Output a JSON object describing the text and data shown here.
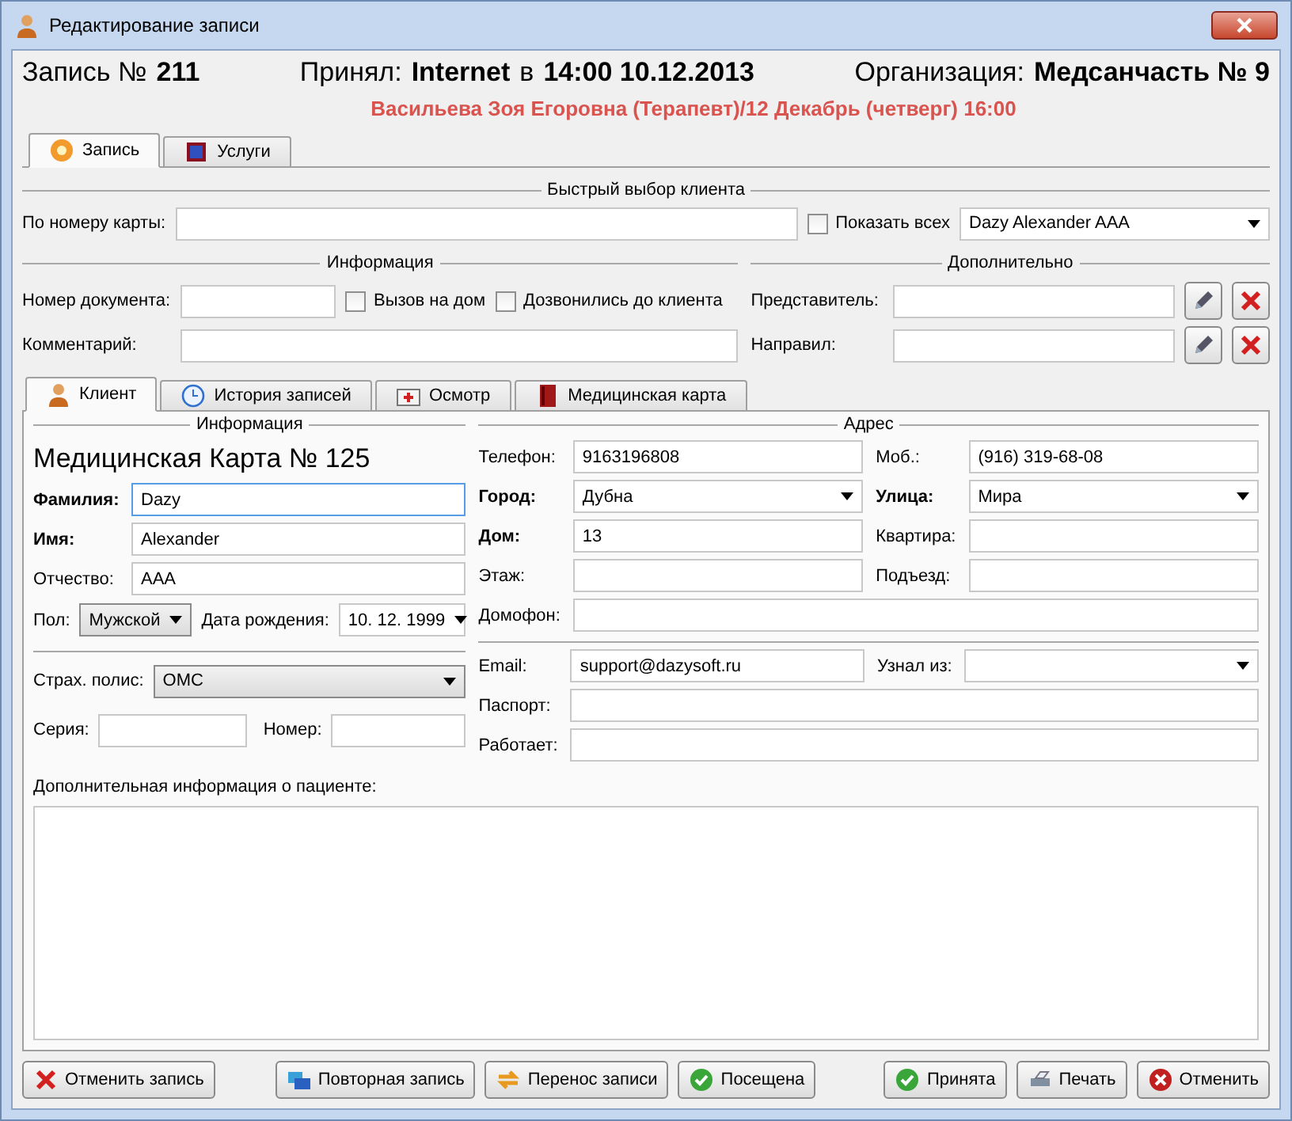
{
  "window": {
    "title": "Редактирование записи"
  },
  "header": {
    "record_label": "Запись №",
    "record_number": "211",
    "accepted_label": "Принял:",
    "accepted_by": "Internet",
    "at_word": "в",
    "accepted_time": "14:00 10.12.2013",
    "org_label": "Организация:",
    "org_name": "Медсанчасть № 9",
    "appointment": "Васильева Зоя Егоровна (Терапевт)/12 Декабрь (четверг) 16:00"
  },
  "top_tabs": [
    {
      "label": "Запись",
      "selected": true
    },
    {
      "label": "Услуги",
      "selected": false
    }
  ],
  "quick_select": {
    "title": "Быстрый выбор клиента",
    "card_label": "По номеру карты:",
    "show_all": {
      "label": "Показать всех",
      "checked": false
    },
    "client": "Dazy Alexander AAA"
  },
  "info": {
    "title": "Информация",
    "doc_label": "Номер документа:",
    "home_call": {
      "label": "Вызов на дом",
      "checked": false
    },
    "called": {
      "label": "Дозвонились до клиента",
      "checked": false
    },
    "comment_label": "Комментарий:"
  },
  "extra": {
    "title": "Дополнительно",
    "rows": [
      {
        "label": "Представитель:"
      },
      {
        "label": "Направил:"
      }
    ]
  },
  "client_tabs": [
    {
      "label": "Клиент",
      "selected": true
    },
    {
      "label": "История записей",
      "selected": false
    },
    {
      "label": "Осмотр",
      "selected": false
    },
    {
      "label": "Медицинская карта",
      "selected": false
    }
  ],
  "client_info": {
    "title": "Информация",
    "card_title": "Медицинская Карта № 125",
    "fields": [
      {
        "label": "Фамилия:",
        "value": "Dazy",
        "required": true,
        "focused": true
      },
      {
        "label": "Имя:",
        "value": "Alexander",
        "required": true,
        "focused": false
      },
      {
        "label": "Отчество:",
        "value": "AAA",
        "required": false,
        "focused": false
      }
    ],
    "sex": {
      "label": "Пол:",
      "value": "Мужской"
    },
    "birth": {
      "label": "Дата рождения:",
      "value": "10. 12. 1999"
    },
    "insurance": {
      "label": "Страх. полис:",
      "value": "ОМС"
    },
    "series_label": "Серия:",
    "number_label": "Номер:"
  },
  "address": {
    "title": "Адрес",
    "fields": [
      {
        "kind": "text",
        "label": "Телефон:",
        "value": "9163196808",
        "required": false,
        "wide": false
      },
      {
        "kind": "text",
        "label": "Моб.:",
        "value": "(916) 319-68-08",
        "required": false,
        "wide": false
      },
      {
        "kind": "select",
        "label": "Город:",
        "value": "Дубна",
        "required": true,
        "wide": false
      },
      {
        "kind": "select",
        "label": "Улица:",
        "value": "Мира",
        "required": true,
        "wide": false
      },
      {
        "kind": "text",
        "label": "Дом:",
        "value": "13",
        "required": true,
        "wide": false
      },
      {
        "kind": "text",
        "label": "Квартира:",
        "required": false,
        "wide": false
      },
      {
        "kind": "text",
        "label": "Этаж:",
        "required": false,
        "wide": false
      },
      {
        "kind": "text",
        "label": "Подъезд:",
        "required": false,
        "wide": false
      },
      {
        "kind": "text",
        "label": "Домофон:",
        "required": false,
        "wide": true
      }
    ]
  },
  "contact": {
    "fields": [
      {
        "kind": "text",
        "label": "Email:",
        "value": "support@dazysoft.ru",
        "wide": false
      },
      {
        "kind": "select",
        "label": "Узнал из:",
        "wide": false
      },
      {
        "kind": "text",
        "label": "Паспорт:",
        "wide": true
      },
      {
        "kind": "text",
        "label": "Работает:",
        "wide": true
      }
    ]
  },
  "notes": {
    "label": "Дополнительная информация о пациенте:"
  },
  "left_buttons": [
    {
      "label": "Отменить запись"
    }
  ],
  "middle_buttons": [
    {
      "label": "Повторная запись"
    },
    {
      "label": "Перенос записи"
    },
    {
      "label": "Посещена"
    }
  ],
  "right_buttons": [
    {
      "label": "Принята"
    },
    {
      "label": "Печать"
    },
    {
      "label": "Отменить"
    }
  ]
}
